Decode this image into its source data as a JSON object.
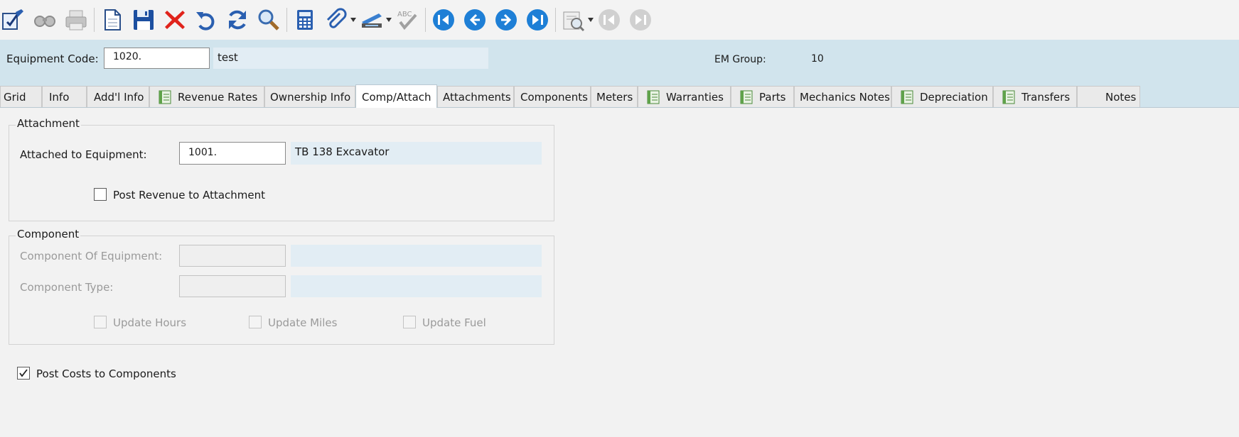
{
  "toolbar": {
    "icons": [
      "edit-icon",
      "binoculars-icon",
      "printer-icon",
      "new-document-icon",
      "save-icon",
      "delete-icon",
      "undo-icon",
      "refresh-icon",
      "search-icon",
      "calculator-icon",
      "attachment-icon",
      "scanner-icon",
      "spellcheck-icon",
      "first-record-icon",
      "previous-record-icon",
      "next-record-icon",
      "last-record-icon",
      "print-preview-icon",
      "nav-back-disabled-icon",
      "nav-forward-disabled-icon"
    ],
    "spellcheck_text": "ABC"
  },
  "header": {
    "equipment_code_label": "Equipment Code:",
    "equipment_code_value": "1020.",
    "equipment_description": "test",
    "em_group_label": "EM Group:",
    "em_group_value": "10"
  },
  "tabs": [
    {
      "label": "Grid"
    },
    {
      "label": "Info"
    },
    {
      "label": "Add'l Info"
    },
    {
      "label": "Revenue Rates"
    },
    {
      "label": "Ownership Info"
    },
    {
      "label": "Comp/Attach"
    },
    {
      "label": "Attachments"
    },
    {
      "label": "Components"
    },
    {
      "label": "Meters"
    },
    {
      "label": "Warranties"
    },
    {
      "label": "Parts"
    },
    {
      "label": "Mechanics Notes"
    },
    {
      "label": "Depreciation"
    },
    {
      "label": "Transfers"
    },
    {
      "label": "Notes"
    }
  ],
  "active_tab": "Comp/Attach",
  "attachment": {
    "title": "Attachment",
    "attached_label": "Attached to Equipment:",
    "attached_value": "1001.",
    "attached_description": "TB 138 Excavator",
    "post_revenue_label": "Post Revenue to Attachment",
    "post_revenue_checked": false
  },
  "component": {
    "title": "Component",
    "component_of_label": "Component Of Equipment:",
    "component_type_label": "Component Type:",
    "update_hours_label": "Update Hours",
    "update_miles_label": "Update Miles",
    "update_fuel_label": "Update Fuel"
  },
  "post_costs": {
    "label": "Post Costs to Components",
    "checked": true
  },
  "colors": {
    "header_band": "#d1e4ed",
    "description_field": "#e2edf4",
    "nav_blue": "#1e7fd6"
  }
}
